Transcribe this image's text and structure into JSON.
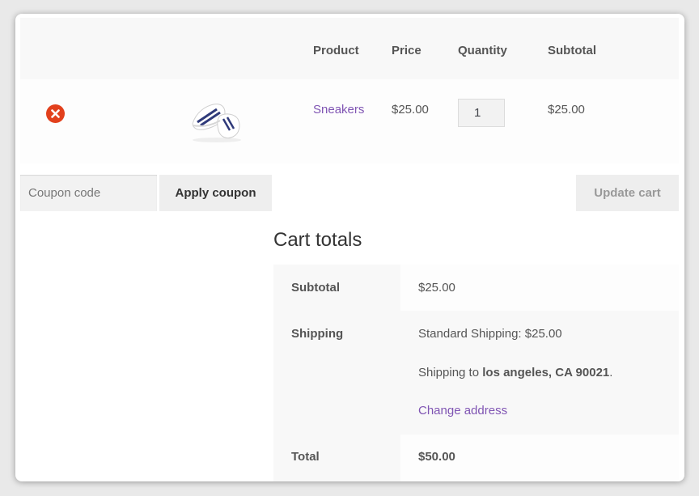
{
  "table": {
    "headers": {
      "product": "Product",
      "price": "Price",
      "quantity": "Quantity",
      "subtotal": "Subtotal"
    },
    "row": {
      "product": "Sneakers",
      "price": "$25.00",
      "quantity": "1",
      "subtotal": "$25.00",
      "remove_icon": "remove-circle-icon",
      "thumbnail": "sneakers-image"
    }
  },
  "coupon": {
    "placeholder": "Coupon code",
    "apply_label": "Apply coupon"
  },
  "update_label": "Update cart",
  "totals": {
    "title": "Cart totals",
    "subtotal_label": "Subtotal",
    "subtotal_value": "$25.00",
    "shipping_label": "Shipping",
    "shipping_method": "Standard Shipping: $25.00",
    "shipping_to_prefix": "Shipping to ",
    "shipping_to_location": "los angeles, CA 90021",
    "shipping_to_suffix": ".",
    "change_address": "Change address",
    "total_label": "Total",
    "total_value": "$50.00"
  },
  "colors": {
    "link": "#7f54b3",
    "remove": "#e2401c",
    "text": "#555555"
  }
}
